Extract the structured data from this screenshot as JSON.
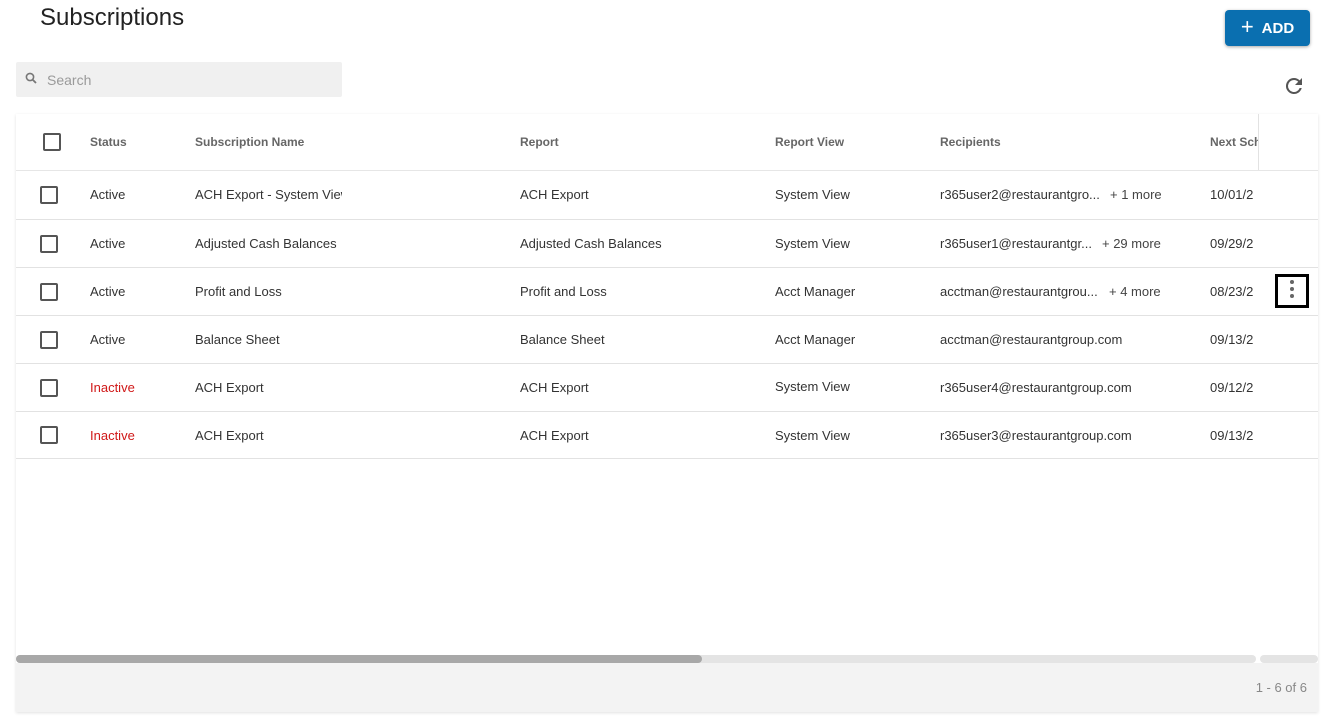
{
  "page": {
    "title": "Subscriptions"
  },
  "toolbar": {
    "add_label": "ADD",
    "add_icon": "plus-icon",
    "refresh_icon": "refresh-icon"
  },
  "search": {
    "placeholder": "Search",
    "value": "",
    "icon": "search-icon"
  },
  "table": {
    "columns": [
      "Status",
      "Subscription Name",
      "Report",
      "Report View",
      "Recipients",
      "Next Sch"
    ],
    "rows": [
      {
        "status": "Active",
        "name": "ACH Export - System View",
        "report": "ACH Export",
        "view": "System View",
        "recipients": "r365user2@restaurantgro...",
        "more": "+ 1 more",
        "next": "10/01/2"
      },
      {
        "status": "Active",
        "name": "Adjusted Cash Balances",
        "report": "Adjusted Cash Balances",
        "view": "System View",
        "recipients": "r365user1@restaurantgr...",
        "more": "+ 29 more",
        "next": "09/29/2"
      },
      {
        "status": "Active",
        "name": "Profit and Loss",
        "report": "Profit and Loss",
        "view": "Acct Manager",
        "recipients": "acctman@restaurantgrou...",
        "more": "+ 4 more",
        "next": "08/23/2"
      },
      {
        "status": "Active",
        "name": "Balance Sheet",
        "report": "Balance Sheet",
        "view": "Acct Manager",
        "recipients": "acctman@restaurantgroup.com",
        "more": "",
        "next": "09/13/2"
      },
      {
        "status": "Inactive",
        "name": "ACH Export",
        "report": "ACH Export",
        "view": "System View",
        "recipients": "r365user4@restaurantgroup.com",
        "more": "",
        "next": "09/12/2"
      },
      {
        "status": "Inactive",
        "name": "ACH Export",
        "report": "ACH Export",
        "view": "System View",
        "recipients": "r365user3@restaurantgroup.com",
        "more": "",
        "next": "09/13/2"
      }
    ],
    "row_actions_icon": "more-vert-icon"
  },
  "colors": {
    "accent": "#0a6fb0",
    "inactive": "#d01818"
  },
  "footer": {
    "pager": "1 - 6 of 6"
  }
}
